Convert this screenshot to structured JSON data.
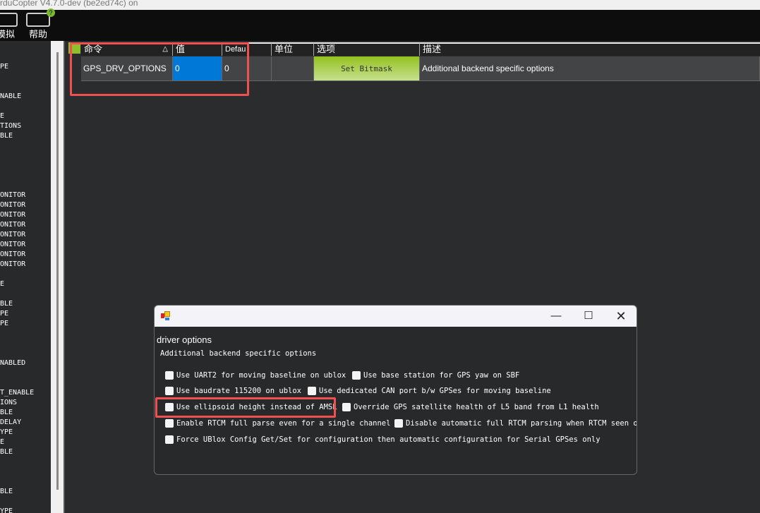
{
  "window": {
    "title": "rduCopter V4.7.0-dev (be2ed74c) on"
  },
  "toolbar": {
    "simulation_label": "模拟",
    "help_label": "帮助"
  },
  "sidebar": {
    "rows": [
      {
        "i": 0,
        "t": "PE"
      },
      {
        "i": 3,
        "t": "NABLE"
      },
      {
        "i": 5,
        "t": "E"
      },
      {
        "i": 6,
        "t": "TIONS"
      },
      {
        "i": 7,
        "t": "BLE"
      },
      {
        "i": 13,
        "t": "ONITOR"
      },
      {
        "i": 14,
        "t": "ONITOR"
      },
      {
        "i": 15,
        "t": "ONITOR"
      },
      {
        "i": 16,
        "t": "ONITOR"
      },
      {
        "i": 17,
        "t": "ONITOR"
      },
      {
        "i": 18,
        "t": "ONITOR"
      },
      {
        "i": 19,
        "t": "ONITOR"
      },
      {
        "i": 20,
        "t": "ONITOR"
      },
      {
        "i": 22,
        "t": "E"
      },
      {
        "i": 24,
        "t": "BLE"
      },
      {
        "i": 25,
        "t": "PE"
      },
      {
        "i": 26,
        "t": "PE"
      },
      {
        "i": 30,
        "t": "NABLED"
      },
      {
        "i": 33,
        "t": "T_ENABLE"
      },
      {
        "i": 34,
        "t": "IONS"
      },
      {
        "i": 35,
        "t": "BLE"
      },
      {
        "i": 36,
        "t": "DELAY"
      },
      {
        "i": 37,
        "t": "YPE"
      },
      {
        "i": 38,
        "t": "E"
      },
      {
        "i": 39,
        "t": "BLE"
      },
      {
        "i": 43,
        "t": "BLE"
      },
      {
        "i": 45,
        "t": "YPE"
      }
    ]
  },
  "grid": {
    "headers": {
      "command": "命令",
      "sort_indicator": "△",
      "value": "值",
      "default": "Defau",
      "units": "单位",
      "options": "选项",
      "description": "描述"
    },
    "row": {
      "command": "GPS_DRV_OPTIONS",
      "value": "0",
      "default": "0",
      "units": "",
      "options_button": "Set Bitmask",
      "description": "Additional backend specific options"
    },
    "selected_color": "#0078d7"
  },
  "dialog": {
    "heading": "driver options",
    "subtitle": "Additional backend specific options",
    "options": [
      {
        "label": "Use UART2 for moving baseline on ublox",
        "checked": false
      },
      {
        "label": "Use base station for GPS yaw on SBF",
        "checked": false
      },
      {
        "label": "Use baudrate 115200 on ublox",
        "checked": false
      },
      {
        "label": "Use dedicated CAN port b/w GPSes for moving baseline",
        "checked": false
      },
      {
        "label": "Use ellipsoid height instead of AMSL",
        "checked": false
      },
      {
        "label": "Override GPS satellite health of L5 band from L1 health",
        "checked": false
      },
      {
        "label": "Enable RTCM full parse even for a single channel",
        "checked": false
      },
      {
        "label": "Disable automatic full RTCM parsing when RTCM seen on",
        "checked": false
      },
      {
        "label": "Force UBlox Config Get/Set for configuration then automatic configuration for Serial GPSes only",
        "checked": false
      }
    ]
  },
  "highlight_color": "#f05050"
}
